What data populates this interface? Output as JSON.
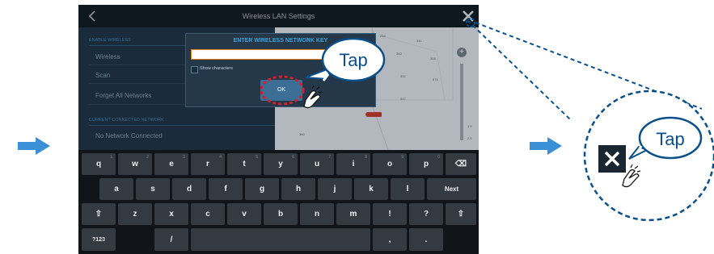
{
  "screen": {
    "title": "Wireless LAN Settings",
    "back_icon": "chevron-left-icon",
    "close_icon": "close-icon"
  },
  "settings": {
    "section_wireless": "ENABLE WIRELESS",
    "item_wireless": "Wireless",
    "item_scan": "Scan",
    "item_forget": "Forget All Networks",
    "section_connected": "CURRENT CONNECTED NETWORK",
    "item_connected": "No Network Connected"
  },
  "map": {
    "depths": [
      "254",
      "341",
      "342",
      "308",
      "352",
      "374",
      "347",
      "360",
      "1.5",
      "2.5"
    ],
    "zoom_plus": "+"
  },
  "dialog": {
    "title": "ENTER WIRELESS NETWORK KEY",
    "key_value": "",
    "show_characters": "Show characters",
    "ok_label": "OK"
  },
  "keyboard": {
    "row1": [
      "q",
      "w",
      "e",
      "r",
      "t",
      "y",
      "u",
      "i",
      "o",
      "p"
    ],
    "row1_hints": [
      "1",
      "2",
      "3",
      "4",
      "5",
      "6",
      "7",
      "8",
      "9",
      "0"
    ],
    "row2": [
      "a",
      "s",
      "d",
      "f",
      "g",
      "h",
      "j",
      "k",
      "l"
    ],
    "next_label": "Next",
    "row3": [
      "z",
      "x",
      "c",
      "v",
      "b",
      "n",
      "m",
      "!",
      "?"
    ],
    "shift_icon": "⇧",
    "backspace_icon": "⌫",
    "symbols_label": "?123",
    "slash_label": "/",
    "comma_label": ",",
    "period_label": "."
  },
  "callouts": {
    "tap_ok": "Tap",
    "tap_close": "Tap"
  },
  "colors": {
    "accent": "#3aa2d8",
    "callout_blue": "#0b4f8a",
    "arrow_blue": "#3b8fd6"
  }
}
